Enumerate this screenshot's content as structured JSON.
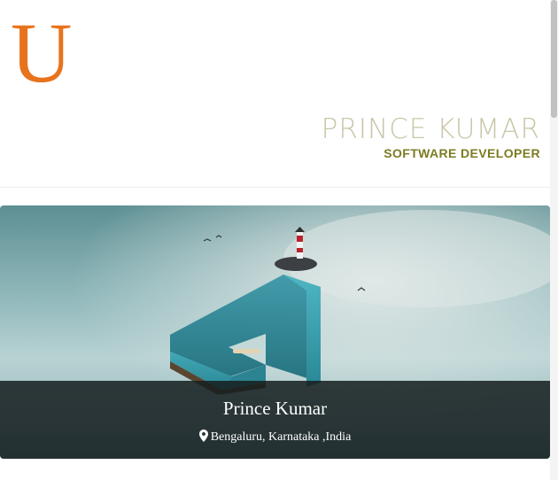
{
  "header": {
    "logo_letter": "U",
    "name": "PRINCE KUMAR",
    "role": "SOFTWARE DEVELOPER"
  },
  "profile_card": {
    "name": "Prince Kumar",
    "location": "Bengaluru, Karnataka ,India",
    "location_icon": "map-marker-icon"
  },
  "colors": {
    "logo": "#e8731d",
    "name": "#c9c6a9",
    "role": "#7c7b22",
    "caption_background": "#161e1f"
  }
}
